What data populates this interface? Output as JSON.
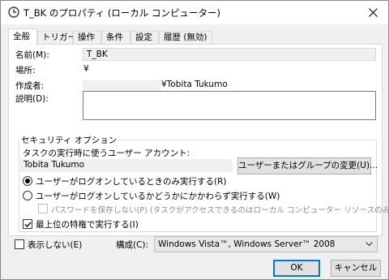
{
  "window": {
    "title": "T_BK のプロパティ (ローカル コンピューター)",
    "icon": "clock-icon",
    "close_icon": "close-icon"
  },
  "tabs": [
    {
      "label": "全般",
      "active": true
    },
    {
      "label": "トリガー",
      "active": false
    },
    {
      "label": "操作",
      "active": false
    },
    {
      "label": "条件",
      "active": false
    },
    {
      "label": "設定",
      "active": false
    },
    {
      "label": "履歴 (無効)",
      "active": false
    }
  ],
  "general": {
    "name_label": "名前(M):",
    "name_value": "T_BK",
    "location_label": "場所:",
    "location_value": "¥",
    "author_label": "作成者:",
    "author_value": "¥Tobita Tukumo",
    "description_label": "説明(D):",
    "description_value": ""
  },
  "security": {
    "group_title": "セキュリティ オプション",
    "account_label": "タスクの実行時に使うユーザー アカウント:",
    "account_value": "Tobita Tukumo",
    "change_button": "ユーザーまたはグループの変更(U)...",
    "radio_logged_on": "ユーザーがログオンしているときのみ実行する(R)",
    "radio_whether": "ユーザーがログオンしているかどうかにかかわらず実行する(W)",
    "radio_selected": "logged_on",
    "no_store_password": "パスワードを保存しない(P) (タスクがアクセスできるのはローカル コンピューター リソースのみ)",
    "highest_privileges": "最上位の特権で実行する(I)",
    "highest_privileges_checked": true
  },
  "footer": {
    "hidden_label": "表示しない(E)",
    "hidden_checked": false,
    "configure_label": "構成(C):",
    "configure_value": "Windows Vista™, Windows Server™ 2008",
    "ok_button": "OK",
    "cancel_button": "キャンセル"
  },
  "colors": {
    "accent": "#0078d7",
    "dialog_bg": "#f0f0f0",
    "panel_bg": "#ffffff"
  }
}
